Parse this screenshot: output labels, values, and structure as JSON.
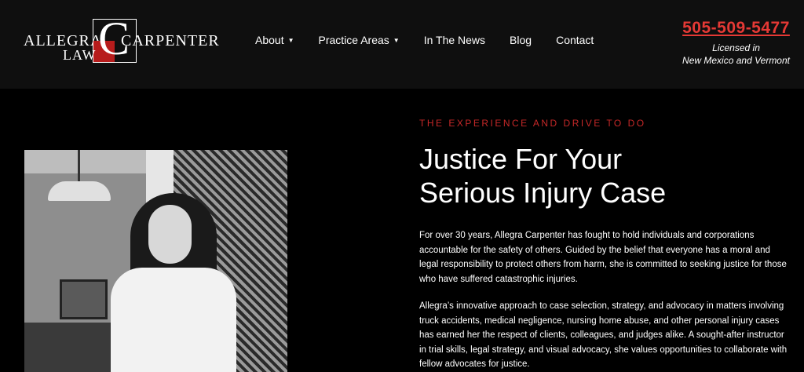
{
  "logo": {
    "word_allegra": "ALLEGRA",
    "word_carpenter": "CARPENTER",
    "word_law": "LAW",
    "monogram": "C"
  },
  "nav": {
    "items": [
      {
        "label": "About",
        "dropdown": true
      },
      {
        "label": "Practice Areas",
        "dropdown": true
      },
      {
        "label": "In The News",
        "dropdown": false
      },
      {
        "label": "Blog",
        "dropdown": false
      },
      {
        "label": "Contact",
        "dropdown": false
      }
    ]
  },
  "contact": {
    "phone": "505-509-5477",
    "licensed_line1": "Licensed in",
    "licensed_line2": "New Mexico and Vermont"
  },
  "hero": {
    "eyebrow": "THE EXPERIENCE AND DRIVE TO DO",
    "headline_line1": "Justice For Your",
    "headline_line2": "Serious Injury Case",
    "paragraph1": "For over 30 years, Allegra Carpenter has fought to hold individuals and corporations accountable for the safety of others. Guided by the belief that everyone has a moral and legal responsibility to protect others from harm, she is committed to seeking justice for those who have suffered catastrophic injuries.",
    "paragraph2": "Allegra’s innovative approach to case selection, strategy, and advocacy in matters involving truck accidents, medical negligence, nursing home abuse, and other personal injury cases has earned her the respect of clients, colleagues, and judges alike. A sought-after instructor in trial skills, legal strategy, and visual advocacy, she values opportunities to collaborate with fellow advocates for justice."
  },
  "colors": {
    "accent_red": "#e53935",
    "eyebrow_red": "#c62828",
    "header_bg": "#0f0f0f",
    "page_bg": "#000000"
  },
  "icons": {
    "dropdown": "chevron-down-icon"
  }
}
